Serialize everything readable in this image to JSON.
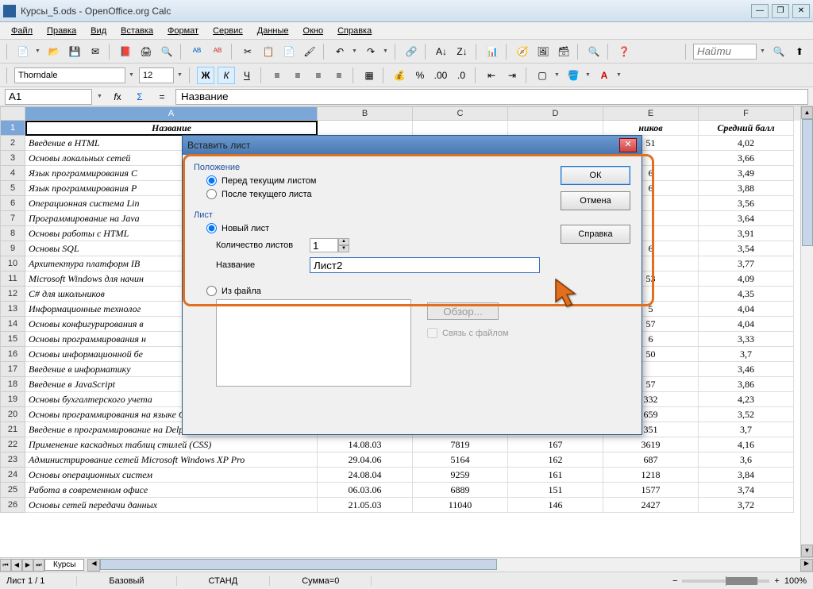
{
  "window": {
    "title": "Курсы_5.ods - OpenOffice.org Calc"
  },
  "menu": {
    "file": "Файл",
    "edit": "Правка",
    "view": "Вид",
    "insert": "Вставка",
    "format": "Формат",
    "service": "Сервис",
    "data": "Данные",
    "window": "Окно",
    "help": "Справка"
  },
  "font": {
    "name": "Thorndale",
    "size": "12"
  },
  "cellref": {
    "value": "A1"
  },
  "formula": {
    "value": "Название"
  },
  "find": {
    "placeholder": "Найти"
  },
  "cols": {
    "A_w": 368,
    "B_w": 120,
    "C_w": 120,
    "D_w": 120,
    "E_w": 120,
    "F_w": 120
  },
  "headers": {
    "A": "Название",
    "B": "",
    "C": "",
    "D": "",
    "E": "ников",
    "F": "Средний балл"
  },
  "rows": [
    {
      "n": "2",
      "a": "Введение в HTML",
      "b": "",
      "c": "",
      "d": "",
      "e": "51",
      "f": "4,02"
    },
    {
      "n": "3",
      "a": "Основы локальных сетей",
      "b": "",
      "c": "",
      "d": "",
      "e": "",
      "f": "3,66"
    },
    {
      "n": "4",
      "a": "Язык программирования C",
      "b": "",
      "c": "",
      "d": "",
      "e": "6",
      "f": "3,49"
    },
    {
      "n": "5",
      "a": "Язык программирования P",
      "b": "",
      "c": "",
      "d": "",
      "e": "6",
      "f": "3,88"
    },
    {
      "n": "6",
      "a": "Операционная система Lin",
      "b": "",
      "c": "",
      "d": "",
      "e": "",
      "f": "3,56"
    },
    {
      "n": "7",
      "a": "Программирование на Java",
      "b": "",
      "c": "",
      "d": "",
      "e": "",
      "f": "3,64"
    },
    {
      "n": "8",
      "a": "Основы работы с HTML",
      "b": "",
      "c": "",
      "d": "",
      "e": "",
      "f": "3,91"
    },
    {
      "n": "9",
      "a": "Основы SQL",
      "b": "",
      "c": "",
      "d": "",
      "e": "6",
      "f": "3,54"
    },
    {
      "n": "10",
      "a": "Архитектура платформ IB",
      "b": "",
      "c": "",
      "d": "",
      "e": "",
      "f": "3,77"
    },
    {
      "n": "11",
      "a": "Microsoft Windows для начин",
      "b": "",
      "c": "",
      "d": "",
      "e": "53",
      "f": "4,09"
    },
    {
      "n": "12",
      "a": "C# для школьников",
      "b": "",
      "c": "",
      "d": "",
      "e": "",
      "f": "4,35"
    },
    {
      "n": "13",
      "a": "Информационные технолог",
      "b": "",
      "c": "",
      "d": "",
      "e": "5",
      "f": "4,04"
    },
    {
      "n": "14",
      "a": "Основы конфигурирования в",
      "b": "",
      "c": "",
      "d": "",
      "e": "57",
      "f": "4,04"
    },
    {
      "n": "15",
      "a": "Основы программирования н",
      "b": "",
      "c": "",
      "d": "",
      "e": "6",
      "f": "3,33"
    },
    {
      "n": "16",
      "a": "Основы информационной бе",
      "b": "",
      "c": "",
      "d": "",
      "e": "50",
      "f": "3,7"
    },
    {
      "n": "17",
      "a": "Введение в информатику",
      "b": "",
      "c": "",
      "d": "",
      "e": "",
      "f": "3,46"
    },
    {
      "n": "18",
      "a": "Введение в JavaScript",
      "b": "",
      "c": "",
      "d": "",
      "e": "57",
      "f": "3,86"
    },
    {
      "n": "19",
      "a": "Основы бухгалтерского учета",
      "b": "08.06.09",
      "c": "1275",
      "d": "183",
      "e": "332",
      "f": "4,23"
    },
    {
      "n": "20",
      "a": "Основы программирования на языке С",
      "b": "26.08.05",
      "c": "4997",
      "d": "170",
      "e": "659",
      "f": "3,52"
    },
    {
      "n": "21",
      "a": "Введение в программирование на Delphi",
      "b": "07.04.08",
      "c": "2121",
      "d": "168",
      "e": "351",
      "f": "3,7"
    },
    {
      "n": "22",
      "a": "Применение каскадных таблиц стилей (CSS)",
      "b": "14.08.03",
      "c": "7819",
      "d": "167",
      "e": "3619",
      "f": "4,16"
    },
    {
      "n": "23",
      "a": "Администрирование сетей Microsoft Windows XP Pro",
      "b": "29.04.06",
      "c": "5164",
      "d": "162",
      "e": "687",
      "f": "3,6"
    },
    {
      "n": "24",
      "a": "Основы операционных систем",
      "b": "24.08.04",
      "c": "9259",
      "d": "161",
      "e": "1218",
      "f": "3,84"
    },
    {
      "n": "25",
      "a": "Работа в современном офисе",
      "b": "06.03.06",
      "c": "6889",
      "d": "151",
      "e": "1577",
      "f": "3,74"
    },
    {
      "n": "26",
      "a": "Основы сетей передачи данных",
      "b": "21.05.03",
      "c": "11040",
      "d": "146",
      "e": "2427",
      "f": "3,72"
    }
  ],
  "tabs": {
    "sheet1": "Курсы"
  },
  "status": {
    "sheet": "Лист 1 / 1",
    "style": "Базовый",
    "mode": "СТАНД",
    "sum": "Сумма=0",
    "zoom": "100%"
  },
  "dialog": {
    "title": "Вставить лист",
    "grp_position": "Положение",
    "radio_before": "Перед текущим листом",
    "radio_after": "После текущего листа",
    "grp_sheet": "Лист",
    "radio_new": "Новый лист",
    "count_label": "Количество листов",
    "count_value": "1",
    "name_label": "Название",
    "name_value": "Лист2",
    "radio_file": "Из файла",
    "browse": "Обзор...",
    "link": "Связь с файлом",
    "ok": "ОК",
    "cancel": "Отмена",
    "help": "Справка"
  }
}
